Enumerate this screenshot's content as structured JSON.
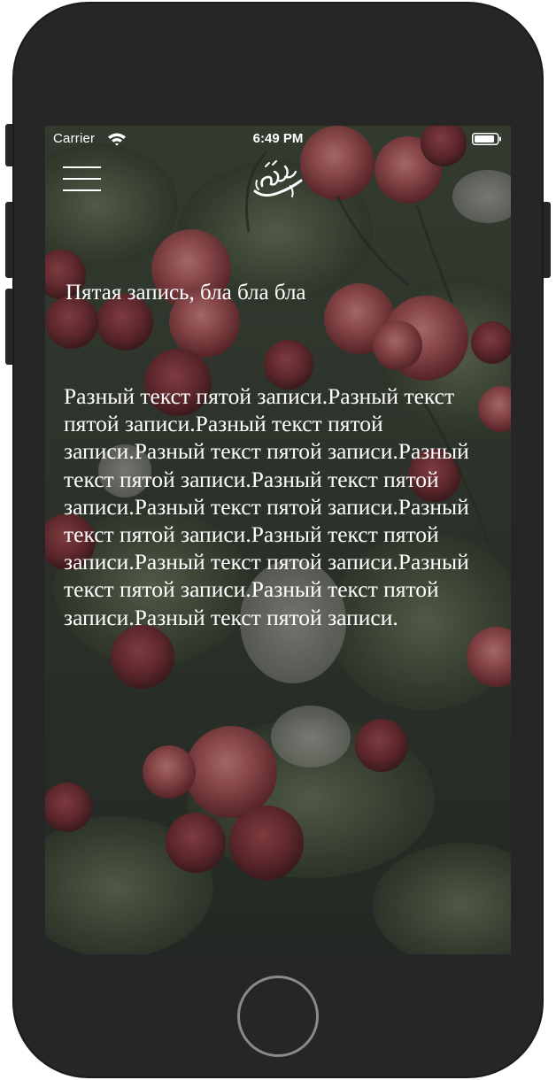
{
  "status_bar": {
    "carrier": "Carrier",
    "time": "6:49 PM",
    "wifi_icon": "wifi-icon",
    "battery_icon": "battery-icon"
  },
  "nav": {
    "menu_icon": "hamburger-menu-icon",
    "logo_icon": "arabic-calligraphy-logo"
  },
  "post": {
    "title": "Пятая запись, бла бла бла",
    "body": "Разный текст пятой записи.Разный текст пятой записи.Разный текст пятой записи.Разный текст пятой записи.Разный текст пятой записи.Разный текст пятой записи.Разный текст пятой записи.Разный текст пятой записи.Разный текст пятой записи.Разный текст пятой записи.Разный текст пятой записи.Разный текст пятой записи.Разный текст пятой записи."
  },
  "theme": {
    "device_color": "#262626",
    "text_color": "#ffffff",
    "background_image": "red roses on dark foliage"
  }
}
